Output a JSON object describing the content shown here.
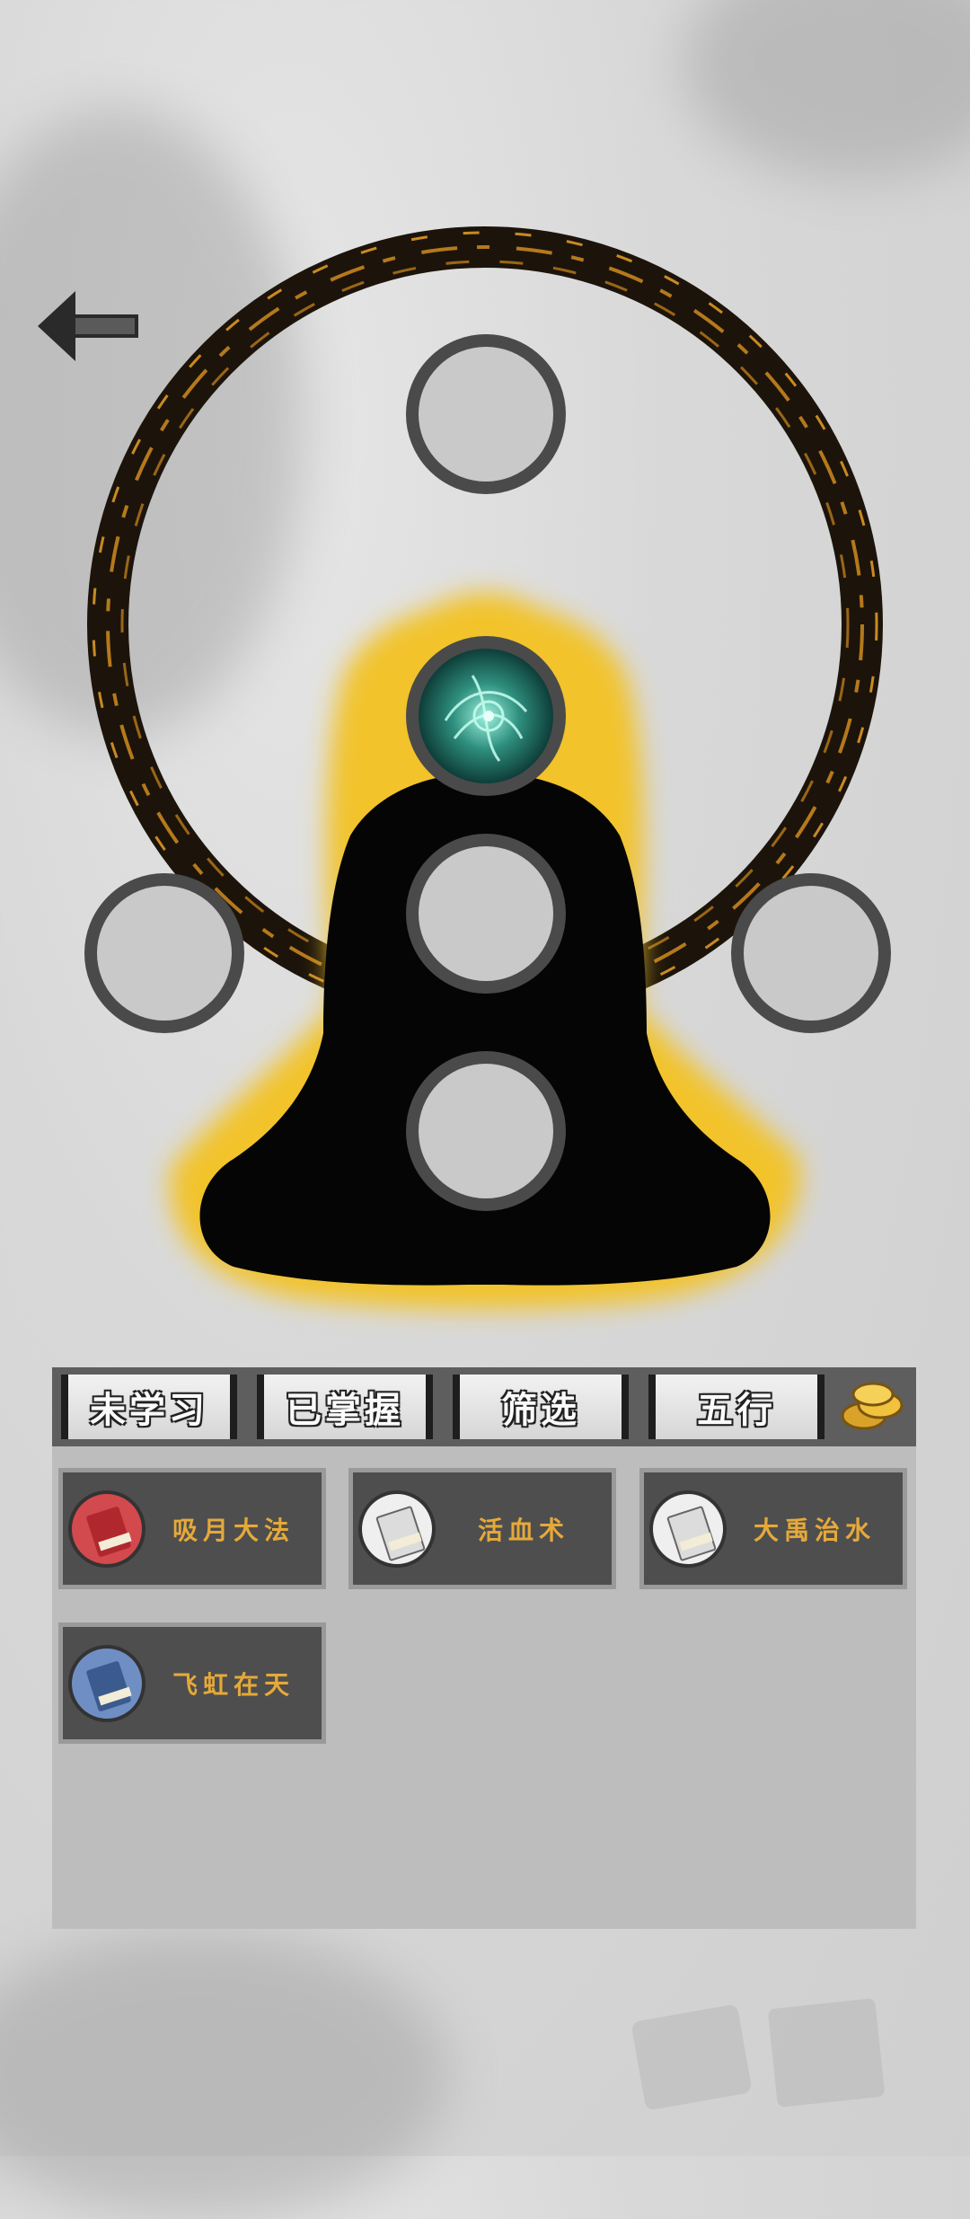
{
  "tabs": [
    {
      "label": "未学习"
    },
    {
      "label": "已掌握"
    },
    {
      "label": "筛选"
    },
    {
      "label": "五行"
    }
  ],
  "skills": [
    {
      "name": "吸月大法",
      "color": "#c9353a"
    },
    {
      "name": "活血术",
      "color": "#e9e9e9"
    },
    {
      "name": "大禹治水",
      "color": "#e9e9e9"
    },
    {
      "name": "飞虹在天",
      "color": "#3b5b8f"
    }
  ],
  "icons": {
    "back": "arrow-left-icon",
    "coins": "coins-icon",
    "equipped_skill": "green-energy-orb-icon"
  },
  "colors": {
    "aura": "#f2c32c",
    "ring": "#b5791c",
    "label": "#e5a93a"
  }
}
